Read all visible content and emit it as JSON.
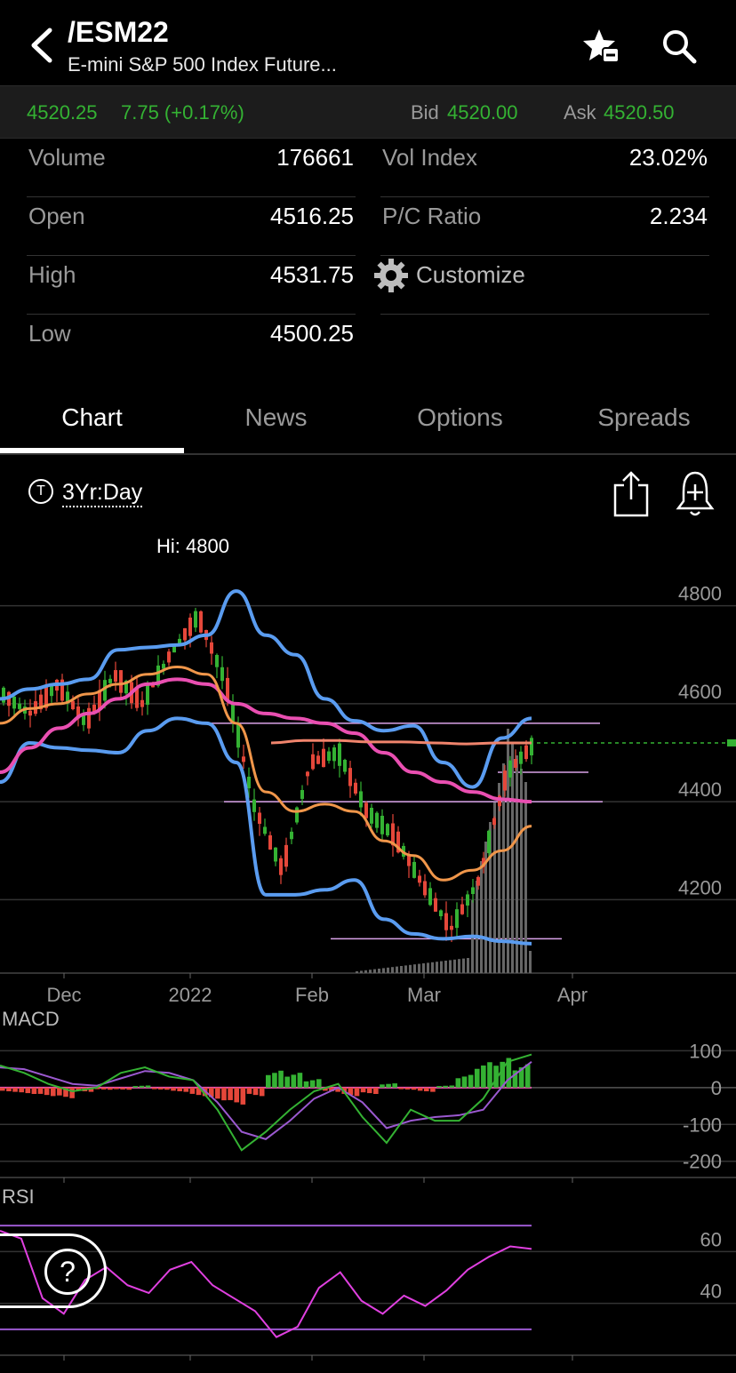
{
  "header": {
    "symbol": "/ESM22",
    "description": "E-mini S&P 500 Index Future..."
  },
  "icons": {
    "back": "chevron-left-icon",
    "watchlist": "star-watchlist-icon",
    "search": "search-icon",
    "customize": "gear-icon",
    "share": "share-icon",
    "alert": "bell-plus-icon",
    "help": "question-icon"
  },
  "quote": {
    "last": "4520.25",
    "change": "7.75 (+0.17%)",
    "bid_label": "Bid",
    "bid": "4520.00",
    "ask_label": "Ask",
    "ask": "4520.50"
  },
  "stats_left": [
    {
      "label": "Volume",
      "value": "176661"
    },
    {
      "label": "Open",
      "value": "4516.25"
    },
    {
      "label": "High",
      "value": "4531.75"
    },
    {
      "label": "Low",
      "value": "4500.25"
    }
  ],
  "stats_right": [
    {
      "label": "Vol Index",
      "value": "23.02%"
    },
    {
      "label": "P/C Ratio",
      "value": "2.234"
    }
  ],
  "customize_label": "Customize",
  "tabs": [
    "Chart",
    "News",
    "Options",
    "Spreads"
  ],
  "active_tab": "Chart",
  "chart_range": {
    "t_badge": "T",
    "label": "3Yr:Day"
  },
  "colors": {
    "up": "#34b233",
    "down": "#e5473a",
    "bollinger": "#5a9cf0",
    "pink": "#e94fb1",
    "orange": "#f0964a",
    "salmon": "#f0846c",
    "violet": "#9b59d0",
    "rsi": "#e040e0"
  },
  "chart_data": [
    {
      "type": "line",
      "annotation": "Hi: 4800",
      "ylim": [
        4050,
        4930
      ],
      "y_ticks": [
        4800,
        4600,
        4400,
        4200
      ],
      "x_ticks": [
        "Dec",
        "2022",
        "Feb",
        "Mar",
        "Apr"
      ],
      "last_price": 4520,
      "series": [
        {
          "role": "bollinger-upper",
          "color": "#5a9cf0",
          "values": [
            4610,
            4630,
            4640,
            4650,
            4710,
            4715,
            4720,
            4740,
            4830,
            4740,
            4700,
            4610,
            4565,
            4545,
            4555,
            4480,
            4430,
            4530,
            4570
          ]
        },
        {
          "role": "bollinger-lower",
          "color": "#5a9cf0",
          "values": [
            4440,
            4520,
            4510,
            4505,
            4500,
            4545,
            4570,
            4560,
            4480,
            4210,
            4210,
            4220,
            4240,
            4160,
            4130,
            4120,
            4125,
            4115,
            4110
          ]
        },
        {
          "role": "slow-ma",
          "color": "#e94fb1",
          "values": [
            4460,
            4510,
            4550,
            4580,
            4610,
            4640,
            4650,
            4640,
            4600,
            4580,
            4570,
            4560,
            4540,
            4500,
            4460,
            4440,
            4420,
            4405,
            4400
          ]
        },
        {
          "role": "mid-ma",
          "color": "#f0964a",
          "values": [
            4560,
            4590,
            4600,
            4620,
            4640,
            4660,
            4675,
            4660,
            4560,
            4420,
            4380,
            4395,
            4380,
            4320,
            4290,
            4240,
            4260,
            4300,
            4350
          ]
        },
        {
          "role": "flat-ma",
          "color": "#f0846c",
          "values": [
            4520,
            4525,
            4525,
            4522,
            4522,
            4520,
            4518,
            4520,
            4520
          ]
        },
        {
          "role": "price",
          "color": "#34b233",
          "values": [
            4620,
            4580,
            4640,
            4560,
            4660,
            4600,
            4700,
            4780,
            4640,
            4390,
            4260,
            4480,
            4500,
            4380,
            4330,
            4230,
            4140,
            4240,
            4460,
            4520
          ]
        }
      ]
    },
    {
      "type": "bar",
      "title": "MACD",
      "ylim": [
        -220,
        130
      ],
      "y_ticks": [
        100,
        0,
        -100,
        -200
      ],
      "histogram": [
        -10,
        -15,
        -20,
        -25,
        -10,
        -5,
        -5,
        5,
        -5,
        -10,
        -20,
        -30,
        -40,
        -20,
        40,
        35,
        20,
        -10,
        -20,
        -15,
        10,
        -5,
        -10,
        5,
        30,
        60,
        70,
        55
      ]
    },
    {
      "type": "line",
      "title": "RSI",
      "ylim": [
        20,
        80
      ],
      "y_ticks": [
        60,
        40
      ],
      "bands": [
        70,
        30
      ],
      "values": [
        68,
        65,
        42,
        36,
        49,
        54,
        47,
        44,
        53,
        56,
        47,
        42,
        37,
        27,
        31,
        46,
        52,
        41,
        36,
        43,
        39,
        45,
        53,
        58,
        62,
        61
      ]
    }
  ]
}
